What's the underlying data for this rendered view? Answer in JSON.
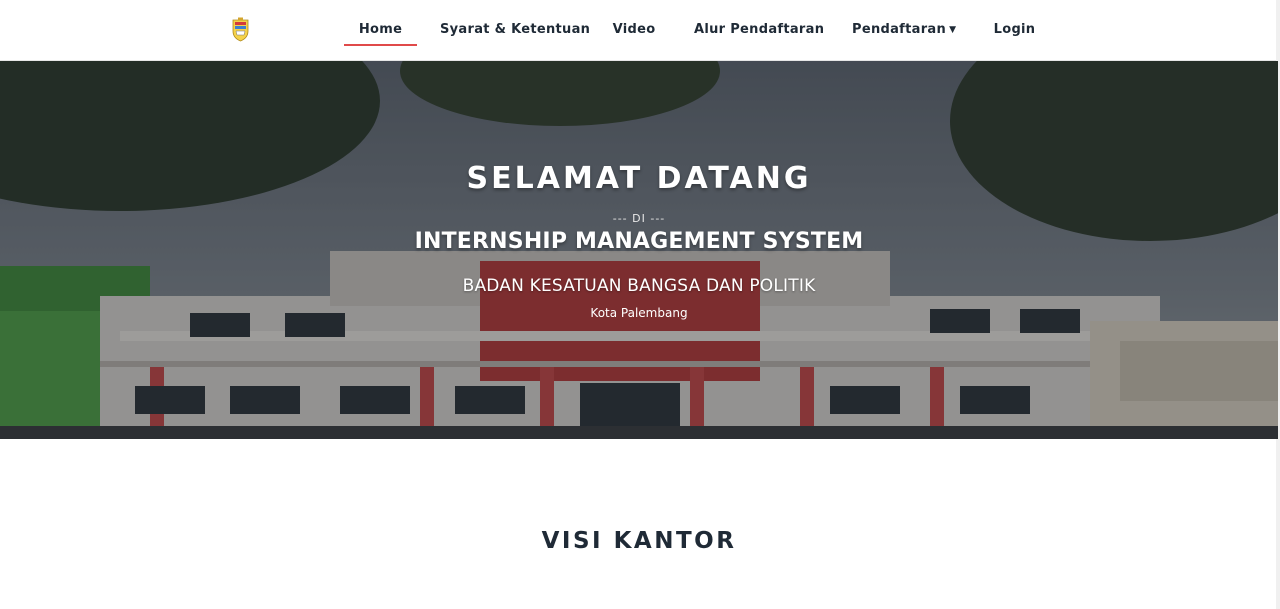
{
  "nav": {
    "items": [
      {
        "label": "Home",
        "active": true
      },
      {
        "label": "Syarat & Ketentuan"
      },
      {
        "label": "Video"
      },
      {
        "label": "Alur Pendaftaran"
      },
      {
        "label": "Pendaftaran",
        "has_dropdown": true,
        "caret_icon": "chevron-down-icon"
      },
      {
        "label": "Login"
      }
    ],
    "active_underline_color": "#e04a4a"
  },
  "hero": {
    "title": "SELAMAT DATANG",
    "subtitle_di": "--- DI ---",
    "system_name": "INTERNSHIP MANAGEMENT SYSTEM",
    "agency": "BADAN KESATUAN BANGSA DAN POLITIK",
    "city": "Kota Palembang"
  },
  "section": {
    "title": "VISI KANTOR"
  }
}
